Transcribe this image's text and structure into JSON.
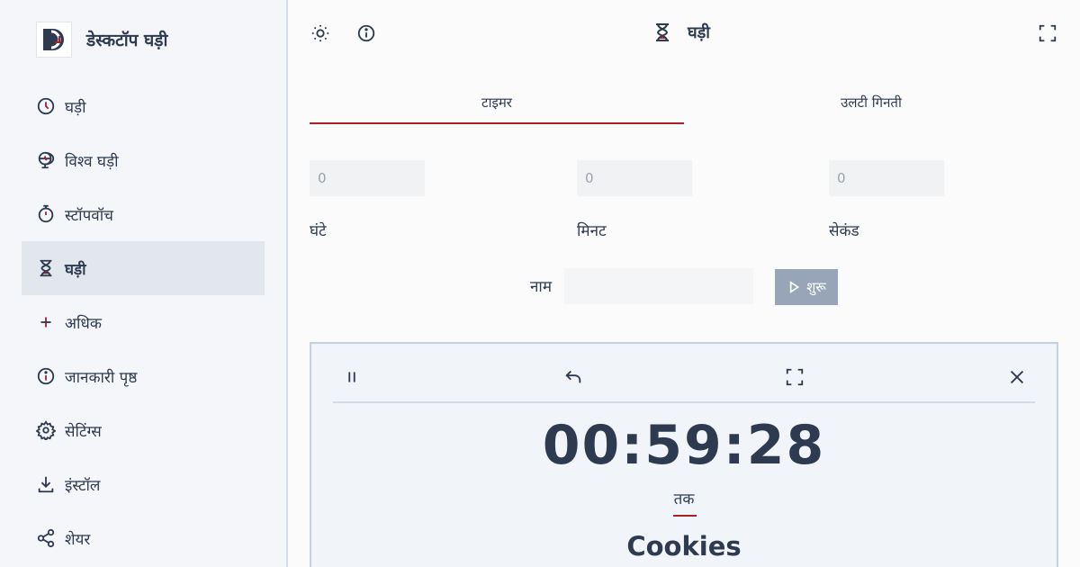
{
  "app": {
    "title": "डेस्कटॉप घड़ी"
  },
  "sidebar": {
    "items": [
      {
        "label": "घड़ी",
        "icon": "clock-icon"
      },
      {
        "label": "विश्व घड़ी",
        "icon": "globe-icon"
      },
      {
        "label": "स्टॉपवॉच",
        "icon": "stopwatch-icon"
      },
      {
        "label": "घड़ी",
        "icon": "hourglass-icon",
        "active": true
      },
      {
        "label": "अधिक",
        "icon": "plus-icon"
      },
      {
        "label": "जानकारी पृष्ठ",
        "icon": "info-icon"
      },
      {
        "label": "सेटिंग्स",
        "icon": "gear-icon"
      },
      {
        "label": "इंस्टॉल",
        "icon": "download-icon"
      },
      {
        "label": "शेयर",
        "icon": "share-icon"
      }
    ]
  },
  "header": {
    "title": "घड़ी"
  },
  "tabs": [
    {
      "label": "टाइमर",
      "active": true
    },
    {
      "label": "उलटी गिनती",
      "active": false
    }
  ],
  "form": {
    "hours": {
      "value": "0",
      "label": "घंटे"
    },
    "minutes": {
      "value": "0",
      "label": "मिनट"
    },
    "seconds": {
      "value": "0",
      "label": "सेकंड"
    },
    "name_label": "नाम",
    "name_value": "",
    "start_label": "शुरू"
  },
  "timer_card": {
    "time": "00:59:28",
    "until_label": "तक",
    "name": "Cookies"
  },
  "colors": {
    "accent": "#a8202a",
    "text": "#2d3a4f",
    "button": "#98a5b8"
  }
}
